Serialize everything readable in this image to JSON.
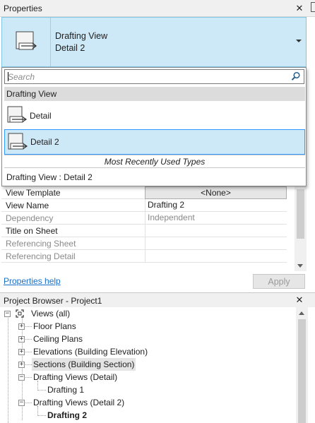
{
  "properties": {
    "title": "Properties",
    "type_selector": {
      "family": "Drafting View",
      "type": "Detail 2"
    },
    "dropdown": {
      "search_placeholder": "Search",
      "family_header": "Drafting View",
      "items": [
        {
          "label": "Detail"
        },
        {
          "label": "Detail 2"
        }
      ],
      "mru_header": "Most Recently Used Types",
      "mru_item": "Drafting View : Detail 2"
    },
    "grid": {
      "rows": [
        {
          "name": "View Template",
          "value": "<None>"
        },
        {
          "name": "View Name",
          "value": "Drafting 2"
        },
        {
          "name": "Dependency",
          "value": "Independent"
        },
        {
          "name": "Title on Sheet",
          "value": ""
        },
        {
          "name": "Referencing Sheet",
          "value": ""
        },
        {
          "name": "Referencing Detail",
          "value": ""
        }
      ]
    },
    "help_link": "Properties help",
    "apply_label": "Apply"
  },
  "project_browser": {
    "title": "Project Browser - Project1",
    "tree": {
      "root": "Views (all)",
      "nodes": [
        {
          "label": "Floor Plans"
        },
        {
          "label": "Ceiling Plans"
        },
        {
          "label": "Elevations (Building Elevation)"
        },
        {
          "label": "Sections (Building Section)"
        },
        {
          "label": "Drafting Views (Detail)"
        },
        {
          "label": "Drafting 1"
        },
        {
          "label": "Drafting Views (Detail 2)"
        },
        {
          "label": "Drafting 2"
        }
      ]
    }
  },
  "colors": {
    "selection_fill": "#cde8f6",
    "selection_border": "#3399ff",
    "link": "#1a6fc9"
  }
}
